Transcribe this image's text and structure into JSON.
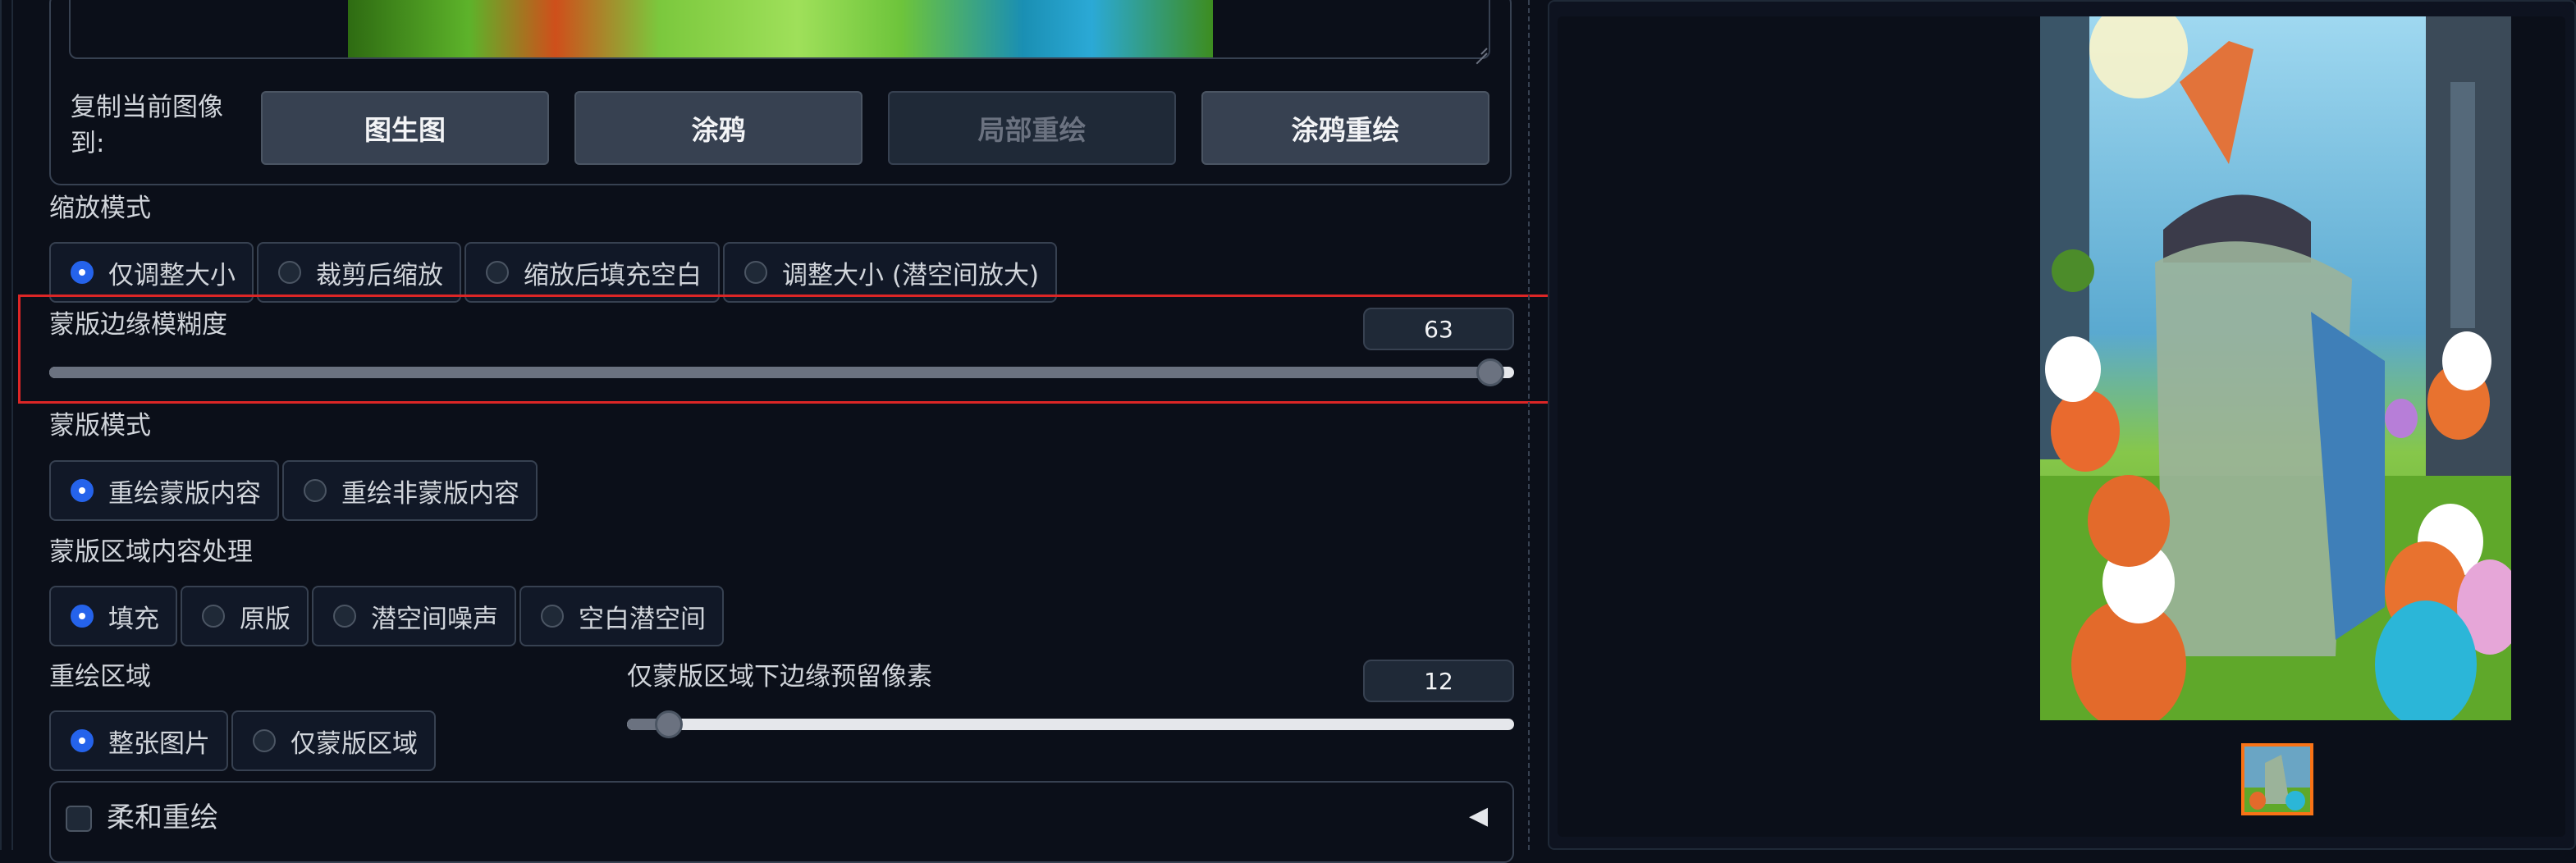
{
  "copy_section": {
    "label_line1": "复制当前图像",
    "label_line2": "到:",
    "buttons": [
      {
        "label": "图生图",
        "enabled": true
      },
      {
        "label": "涂鸦",
        "enabled": true
      },
      {
        "label": "局部重绘",
        "enabled": false
      },
      {
        "label": "涂鸦重绘",
        "enabled": true
      }
    ]
  },
  "resize_mode": {
    "label": "缩放模式",
    "options": [
      "仅调整大小",
      "裁剪后缩放",
      "缩放后填充空白",
      "调整大小 (潜空间放大)"
    ],
    "selected": "仅调整大小"
  },
  "mask_blur": {
    "label": "蒙版边缘模糊度",
    "value": "63",
    "fraction": 0.984
  },
  "mask_mode": {
    "label": "蒙版模式",
    "options": [
      "重绘蒙版内容",
      "重绘非蒙版内容"
    ],
    "selected": "重绘蒙版内容"
  },
  "masked_content": {
    "label": "蒙版区域内容处理",
    "options": [
      "填充",
      "原版",
      "潜空间噪声",
      "空白潜空间"
    ],
    "selected": "填充"
  },
  "inpaint_area": {
    "label": "重绘区域",
    "options": [
      "整张图片",
      "仅蒙版区域"
    ],
    "selected": "整张图片"
  },
  "only_masked_padding": {
    "label": "仅蒙版区域下边缘预留像素",
    "value": "12",
    "fraction": 0.047
  },
  "soft_inpainting": {
    "label": "柔和重绘",
    "checked": false,
    "toggle_glyph": "◀"
  },
  "colors": {
    "background": "#0b0f19",
    "selected_radio": "#2563eb",
    "highlight_border": "#dc2626",
    "thumbnail_border": "#f97316"
  }
}
